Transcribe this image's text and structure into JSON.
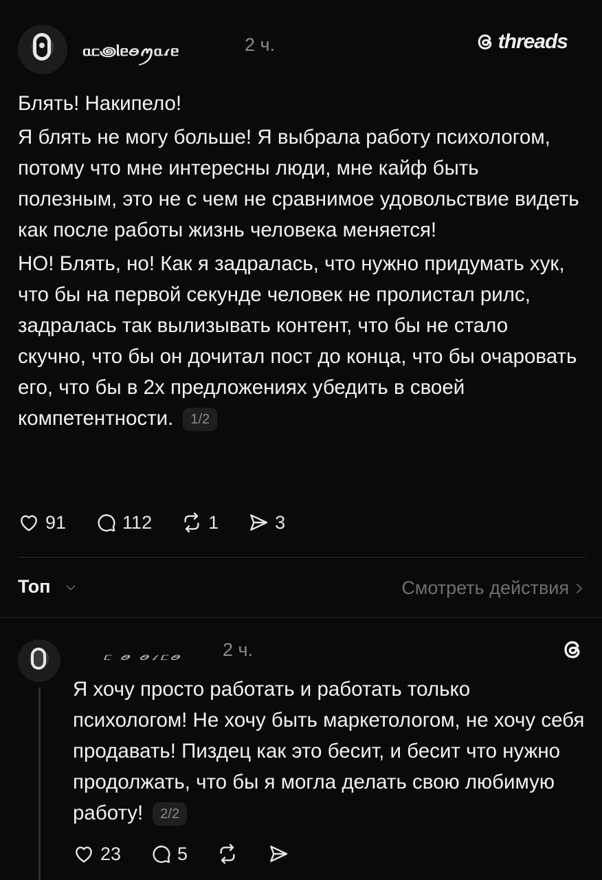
{
  "post": {
    "username": "ᥲᥴ꩜ᥣᥱꪮꪑᥲꪹᥱ",
    "timestamp": "2 ч.",
    "brand": "threads",
    "paragraphs": [
      "Блять! Накипело!",
      "Я блять не могу больше! Я выбрала работу психологом, потому что мне интересны люди, мне кайф быть полезным, это не с чем не сравнимое удовольствие видеть как после работы жизнь человека меняется!",
      "НО! Блять, но! Как я задралась, что нужно придумать хук, что бы на первой секунде человек не пролистал рилс, задралась так вылизывать контент, что бы не стало скучно, что бы он дочитал пост до конца, что бы очаровать его, что бы в 2х предложениях убедить в своей компетентности."
    ],
    "page_indicator": "1/2",
    "actions": {
      "likes": "91",
      "comments": "112",
      "reposts": "1",
      "shares": "3"
    }
  },
  "sort": {
    "label": "Топ",
    "view_activity": "Смотреть действия"
  },
  "reply": {
    "username": "ᥴ ꪮ ꪮꪹᥴꪮ",
    "timestamp": "2 ч.",
    "text": "Я хочу просто работать и работать только психологом! Не хочу быть маркетологом, не хочу себя продавать! Пиздец как это бесит, и бесит что нужно продолжать, что бы я могла делать свою любимую работу!",
    "page_indicator": "2/2",
    "actions": {
      "likes": "23",
      "comments": "5"
    }
  },
  "icons": {
    "brand": "threads-logo-icon",
    "like": "heart-icon",
    "comment": "comment-bubble-icon",
    "repost": "repost-icon",
    "share": "send-icon",
    "sort_chevron": "chevron-down-icon",
    "view_chevron": "chevron-right-icon"
  },
  "colors": {
    "background": "#0a0a0a",
    "text": "#f2f2f2",
    "muted": "#8a8a8a"
  }
}
